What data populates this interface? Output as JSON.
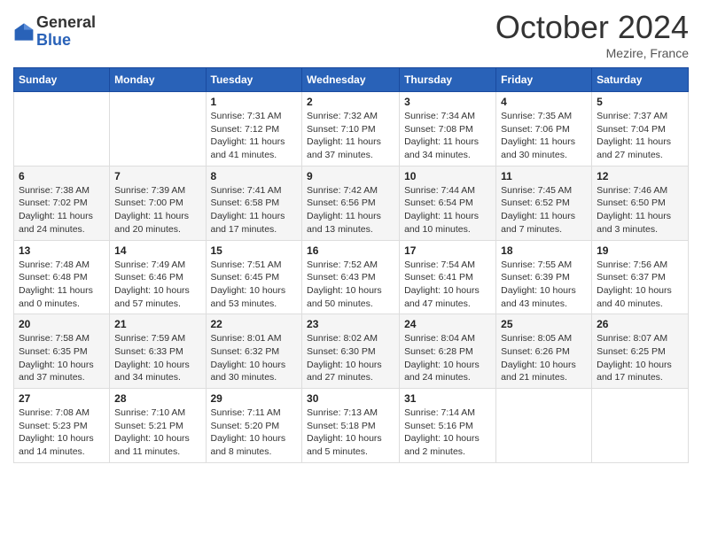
{
  "header": {
    "logo_general": "General",
    "logo_blue": "Blue",
    "month_title": "October 2024",
    "location": "Mezire, France"
  },
  "days_of_week": [
    "Sunday",
    "Monday",
    "Tuesday",
    "Wednesday",
    "Thursday",
    "Friday",
    "Saturday"
  ],
  "weeks": [
    [
      {
        "day": "",
        "sunrise": "",
        "sunset": "",
        "daylight": ""
      },
      {
        "day": "",
        "sunrise": "",
        "sunset": "",
        "daylight": ""
      },
      {
        "day": "1",
        "sunrise": "Sunrise: 7:31 AM",
        "sunset": "Sunset: 7:12 PM",
        "daylight": "Daylight: 11 hours and 41 minutes."
      },
      {
        "day": "2",
        "sunrise": "Sunrise: 7:32 AM",
        "sunset": "Sunset: 7:10 PM",
        "daylight": "Daylight: 11 hours and 37 minutes."
      },
      {
        "day": "3",
        "sunrise": "Sunrise: 7:34 AM",
        "sunset": "Sunset: 7:08 PM",
        "daylight": "Daylight: 11 hours and 34 minutes."
      },
      {
        "day": "4",
        "sunrise": "Sunrise: 7:35 AM",
        "sunset": "Sunset: 7:06 PM",
        "daylight": "Daylight: 11 hours and 30 minutes."
      },
      {
        "day": "5",
        "sunrise": "Sunrise: 7:37 AM",
        "sunset": "Sunset: 7:04 PM",
        "daylight": "Daylight: 11 hours and 27 minutes."
      }
    ],
    [
      {
        "day": "6",
        "sunrise": "Sunrise: 7:38 AM",
        "sunset": "Sunset: 7:02 PM",
        "daylight": "Daylight: 11 hours and 24 minutes."
      },
      {
        "day": "7",
        "sunrise": "Sunrise: 7:39 AM",
        "sunset": "Sunset: 7:00 PM",
        "daylight": "Daylight: 11 hours and 20 minutes."
      },
      {
        "day": "8",
        "sunrise": "Sunrise: 7:41 AM",
        "sunset": "Sunset: 6:58 PM",
        "daylight": "Daylight: 11 hours and 17 minutes."
      },
      {
        "day": "9",
        "sunrise": "Sunrise: 7:42 AM",
        "sunset": "Sunset: 6:56 PM",
        "daylight": "Daylight: 11 hours and 13 minutes."
      },
      {
        "day": "10",
        "sunrise": "Sunrise: 7:44 AM",
        "sunset": "Sunset: 6:54 PM",
        "daylight": "Daylight: 11 hours and 10 minutes."
      },
      {
        "day": "11",
        "sunrise": "Sunrise: 7:45 AM",
        "sunset": "Sunset: 6:52 PM",
        "daylight": "Daylight: 11 hours and 7 minutes."
      },
      {
        "day": "12",
        "sunrise": "Sunrise: 7:46 AM",
        "sunset": "Sunset: 6:50 PM",
        "daylight": "Daylight: 11 hours and 3 minutes."
      }
    ],
    [
      {
        "day": "13",
        "sunrise": "Sunrise: 7:48 AM",
        "sunset": "Sunset: 6:48 PM",
        "daylight": "Daylight: 11 hours and 0 minutes."
      },
      {
        "day": "14",
        "sunrise": "Sunrise: 7:49 AM",
        "sunset": "Sunset: 6:46 PM",
        "daylight": "Daylight: 10 hours and 57 minutes."
      },
      {
        "day": "15",
        "sunrise": "Sunrise: 7:51 AM",
        "sunset": "Sunset: 6:45 PM",
        "daylight": "Daylight: 10 hours and 53 minutes."
      },
      {
        "day": "16",
        "sunrise": "Sunrise: 7:52 AM",
        "sunset": "Sunset: 6:43 PM",
        "daylight": "Daylight: 10 hours and 50 minutes."
      },
      {
        "day": "17",
        "sunrise": "Sunrise: 7:54 AM",
        "sunset": "Sunset: 6:41 PM",
        "daylight": "Daylight: 10 hours and 47 minutes."
      },
      {
        "day": "18",
        "sunrise": "Sunrise: 7:55 AM",
        "sunset": "Sunset: 6:39 PM",
        "daylight": "Daylight: 10 hours and 43 minutes."
      },
      {
        "day": "19",
        "sunrise": "Sunrise: 7:56 AM",
        "sunset": "Sunset: 6:37 PM",
        "daylight": "Daylight: 10 hours and 40 minutes."
      }
    ],
    [
      {
        "day": "20",
        "sunrise": "Sunrise: 7:58 AM",
        "sunset": "Sunset: 6:35 PM",
        "daylight": "Daylight: 10 hours and 37 minutes."
      },
      {
        "day": "21",
        "sunrise": "Sunrise: 7:59 AM",
        "sunset": "Sunset: 6:33 PM",
        "daylight": "Daylight: 10 hours and 34 minutes."
      },
      {
        "day": "22",
        "sunrise": "Sunrise: 8:01 AM",
        "sunset": "Sunset: 6:32 PM",
        "daylight": "Daylight: 10 hours and 30 minutes."
      },
      {
        "day": "23",
        "sunrise": "Sunrise: 8:02 AM",
        "sunset": "Sunset: 6:30 PM",
        "daylight": "Daylight: 10 hours and 27 minutes."
      },
      {
        "day": "24",
        "sunrise": "Sunrise: 8:04 AM",
        "sunset": "Sunset: 6:28 PM",
        "daylight": "Daylight: 10 hours and 24 minutes."
      },
      {
        "day": "25",
        "sunrise": "Sunrise: 8:05 AM",
        "sunset": "Sunset: 6:26 PM",
        "daylight": "Daylight: 10 hours and 21 minutes."
      },
      {
        "day": "26",
        "sunrise": "Sunrise: 8:07 AM",
        "sunset": "Sunset: 6:25 PM",
        "daylight": "Daylight: 10 hours and 17 minutes."
      }
    ],
    [
      {
        "day": "27",
        "sunrise": "Sunrise: 7:08 AM",
        "sunset": "Sunset: 5:23 PM",
        "daylight": "Daylight: 10 hours and 14 minutes."
      },
      {
        "day": "28",
        "sunrise": "Sunrise: 7:10 AM",
        "sunset": "Sunset: 5:21 PM",
        "daylight": "Daylight: 10 hours and 11 minutes."
      },
      {
        "day": "29",
        "sunrise": "Sunrise: 7:11 AM",
        "sunset": "Sunset: 5:20 PM",
        "daylight": "Daylight: 10 hours and 8 minutes."
      },
      {
        "day": "30",
        "sunrise": "Sunrise: 7:13 AM",
        "sunset": "Sunset: 5:18 PM",
        "daylight": "Daylight: 10 hours and 5 minutes."
      },
      {
        "day": "31",
        "sunrise": "Sunrise: 7:14 AM",
        "sunset": "Sunset: 5:16 PM",
        "daylight": "Daylight: 10 hours and 2 minutes."
      },
      {
        "day": "",
        "sunrise": "",
        "sunset": "",
        "daylight": ""
      },
      {
        "day": "",
        "sunrise": "",
        "sunset": "",
        "daylight": ""
      }
    ]
  ]
}
